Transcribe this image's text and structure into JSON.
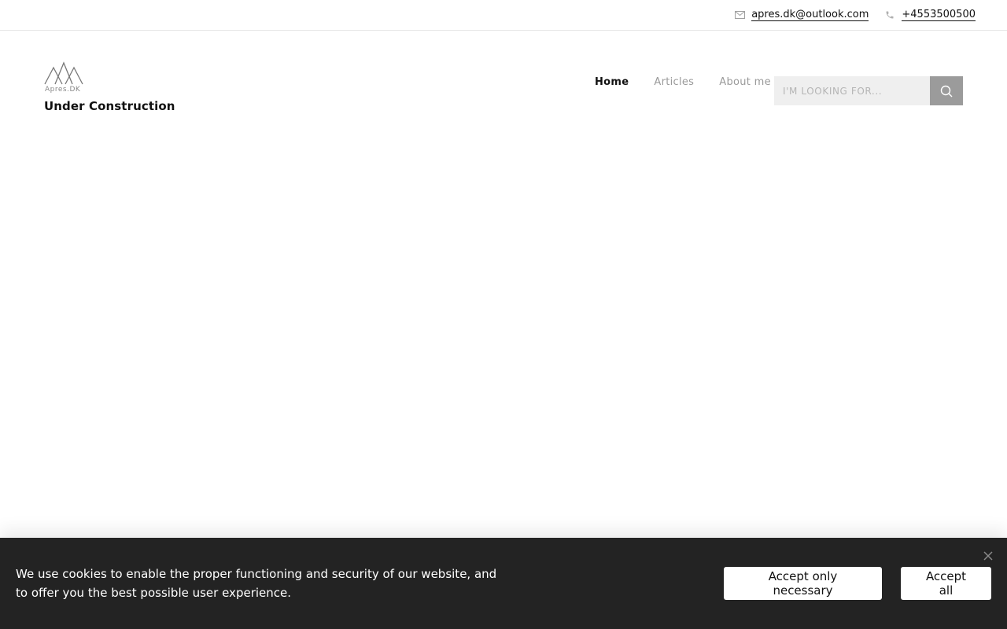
{
  "topbar": {
    "email": "apres.dk@outlook.com",
    "phone": "+4553500500",
    "email_icon": "mail-icon",
    "phone_icon": "phone-icon"
  },
  "brand": {
    "logo_text": "Apres.DK",
    "site_name": "Under Construction"
  },
  "nav": {
    "items": [
      {
        "label": "Home",
        "active": true
      },
      {
        "label": "Articles",
        "active": false
      },
      {
        "label": "About me",
        "active": false
      }
    ]
  },
  "search": {
    "placeholder": "I'M LOOKING FOR...",
    "icon": "search-icon"
  },
  "cookie_banner": {
    "text": "We use cookies to enable the proper functioning and security of our website, and to offer you the best possible user experience.",
    "necessary_label": "Accept only necessary",
    "all_label": "Accept all",
    "close_icon": "close-icon"
  },
  "colors": {
    "banner_bg": "#232323",
    "search_button": "#9b9b9b",
    "search_field": "#efefef",
    "nav_inactive": "#9a9a9a"
  }
}
